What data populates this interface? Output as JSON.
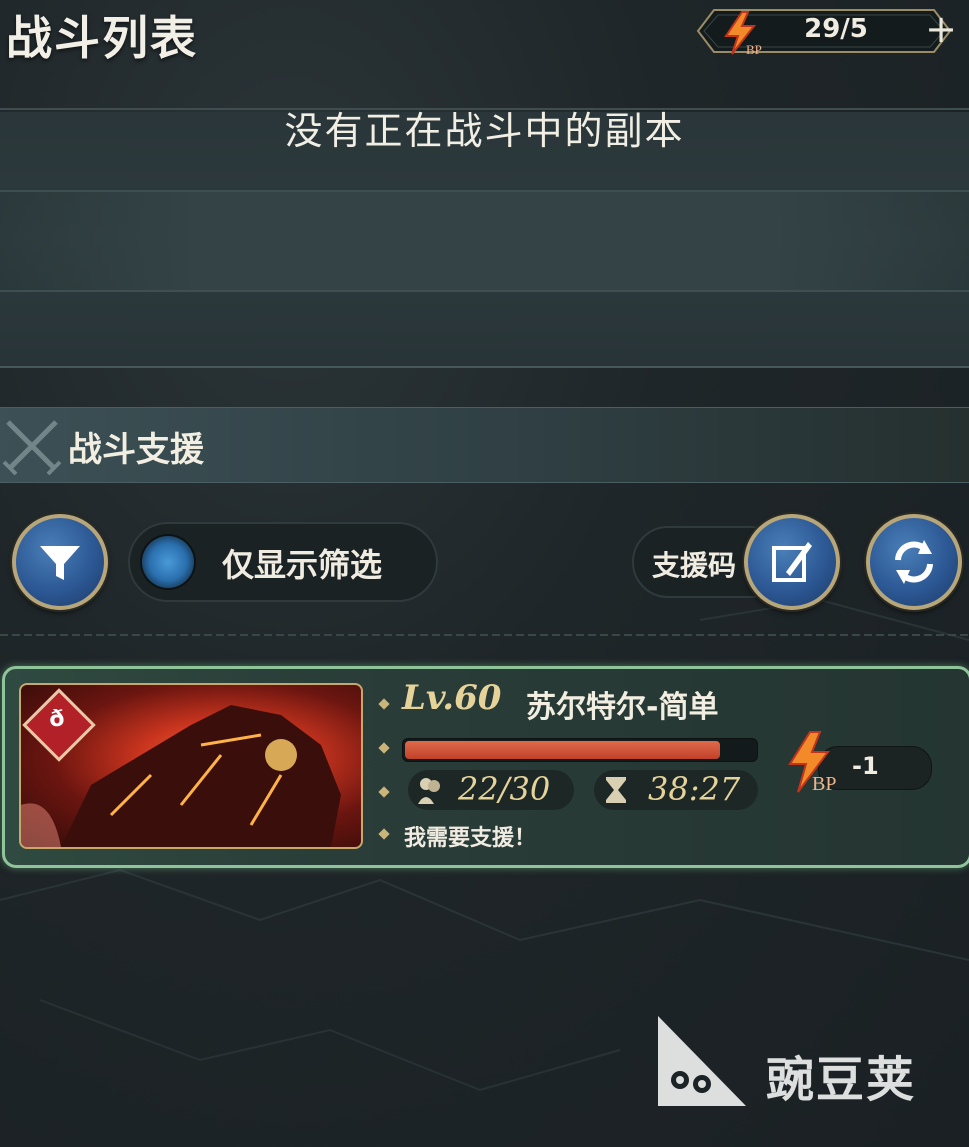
{
  "header": {
    "title": "战斗列表",
    "bp_label": "BP",
    "bp_value": "29/5",
    "add_symbol": "+"
  },
  "active_battles": {
    "empty_message": "没有正在战斗中的副本"
  },
  "support": {
    "section_title": "战斗支援",
    "filter_toggle_label": "仅显示筛选",
    "filter_toggle_on": false,
    "support_code_label": "支援码"
  },
  "raid": {
    "level": "Lv.60",
    "boss_name": "苏尔特尔-简单",
    "hp_fraction": 0.9,
    "participants": "22/30",
    "time_left": "38:27",
    "message": "我需要支援！",
    "bp_label": "BP",
    "bp_cost": "-1",
    "element": "fire"
  },
  "watermark": {
    "text": "豌豆荚"
  },
  "colors": {
    "accent_gold": "#c9b47a",
    "card_border": "#8fc49a",
    "hp": "#c0412a",
    "button_blue": "#2c5894"
  }
}
